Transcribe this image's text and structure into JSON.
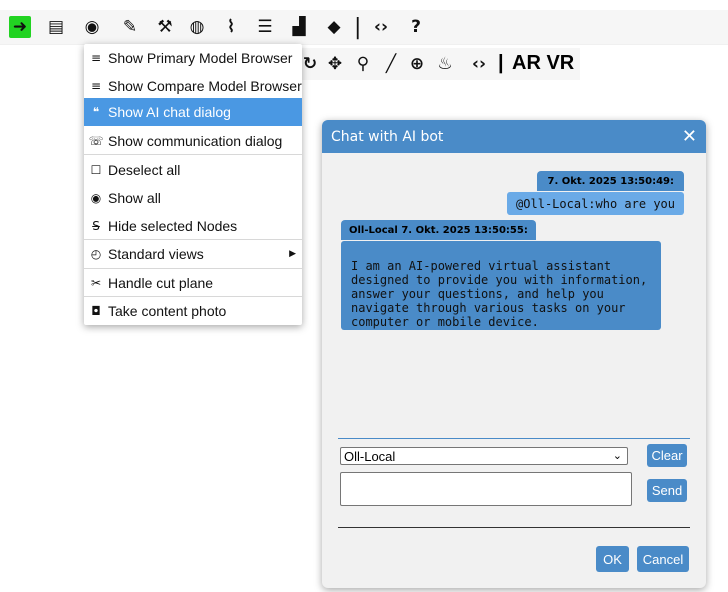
{
  "toolbar": {
    "icons": [
      "login-icon",
      "document-icon",
      "eye-icon",
      "edit-icon",
      "wrench-icon",
      "palette-icon",
      "paperclip-icon",
      "list-icon",
      "chart-icon",
      "tag-icon",
      "code-icon",
      "help-icon"
    ],
    "separator": "|"
  },
  "toolbar2": {
    "icons": [
      "rotate-icon",
      "move-icon",
      "zoom-icon",
      "measure-icon",
      "globe-icon",
      "fire-icon",
      "code-icon"
    ],
    "separator": "|",
    "ar_vr_label": "AR VR"
  },
  "menu": {
    "items": [
      {
        "label": "Show Primary Model Browser",
        "icon": "primary-browser-icon"
      },
      {
        "label": "Show Compare Model Browser",
        "icon": "compare-browser-icon"
      },
      {
        "label": "Show AI chat dialog",
        "icon": "chat-icon"
      },
      {
        "label": "Show communication dialog",
        "icon": "phone-icon"
      },
      {
        "label": "Deselect all",
        "icon": "square-icon"
      },
      {
        "label": "Show all",
        "icon": "eye-icon"
      },
      {
        "label": "Hide selected Nodes",
        "icon": "strikethrough-icon"
      },
      {
        "label": "Standard views",
        "icon": "compass-icon"
      },
      {
        "label": "Handle cut plane",
        "icon": "scissors-icon"
      },
      {
        "label": "Take content photo",
        "icon": "camera-icon"
      }
    ]
  },
  "dialog": {
    "title": "Chat with AI bot",
    "close_label": "✕",
    "messages": [
      {
        "sender_line": "7. Okt. 2025 13:50:49:",
        "text": "@Oll-Local:who are you"
      },
      {
        "sender_line": "Oll-Local 7. Okt. 2025 13:50:55:",
        "text": "I am an AI-powered virtual assistant designed to provide you with information, answer your questions, and help you navigate through various tasks on your computer or mobile device."
      }
    ],
    "model_selected": "Oll-Local",
    "clear_label": "Clear",
    "send_label": "Send",
    "message_value": "",
    "ok_label": "OK",
    "cancel_label": "Cancel"
  },
  "colors": {
    "accent": "#4a8bc8",
    "menu_highlight": "#4a98e3",
    "active_button": "#22d322",
    "user_bubble": "#6aaae7"
  }
}
